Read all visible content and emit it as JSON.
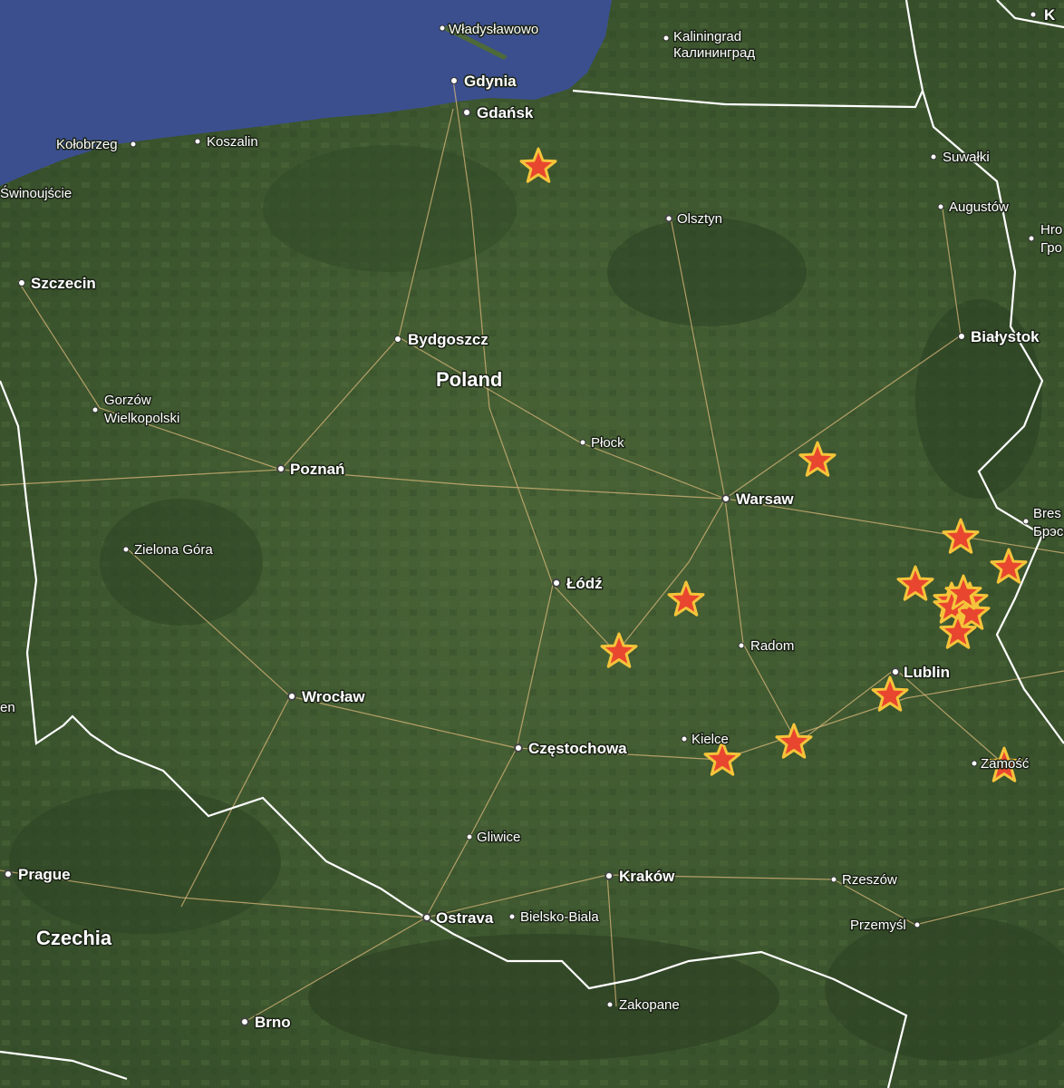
{
  "map": {
    "places": [
      {
        "id": "wladyslawowo",
        "name": "Władysławowo",
        "size": "small"
      },
      {
        "id": "kaliningrad",
        "name": "Kaliningrad",
        "name2": "Калининград",
        "size": "small"
      },
      {
        "id": "gdynia",
        "name": "Gdynia",
        "size": "med"
      },
      {
        "id": "gdansk",
        "name": "Gdańsk",
        "size": "med"
      },
      {
        "id": "kolobrzeg",
        "name": "Kołobrzeg",
        "size": "small"
      },
      {
        "id": "koszalin",
        "name": "Koszalin",
        "size": "small"
      },
      {
        "id": "swinoujscie",
        "name": "Świnoujście",
        "size": "small"
      },
      {
        "id": "suwalki",
        "name": "Suwałki",
        "size": "small"
      },
      {
        "id": "augustow",
        "name": "Augustów",
        "size": "small"
      },
      {
        "id": "olsztyn",
        "name": "Olsztyn",
        "size": "small"
      },
      {
        "id": "szczecin",
        "name": "Szczecin",
        "size": "med"
      },
      {
        "id": "bydgoszcz",
        "name": "Bydgoszcz",
        "size": "med"
      },
      {
        "id": "bialystok",
        "name": "Białystok",
        "size": "med"
      },
      {
        "id": "gorzow",
        "name": "Gorzów",
        "name2": "Wielkopolski",
        "size": "small"
      },
      {
        "id": "plock",
        "name": "Płock",
        "size": "small"
      },
      {
        "id": "poznan",
        "name": "Poznań",
        "size": "med"
      },
      {
        "id": "warsaw",
        "name": "Warsaw",
        "size": "med"
      },
      {
        "id": "zielona",
        "name": "Zielona Góra",
        "size": "small"
      },
      {
        "id": "lodz",
        "name": "Łódź",
        "size": "med"
      },
      {
        "id": "radom",
        "name": "Radom",
        "size": "small"
      },
      {
        "id": "lublin",
        "name": "Lublin",
        "size": "med"
      },
      {
        "id": "wroclaw",
        "name": "Wrocław",
        "size": "med"
      },
      {
        "id": "czestochowa",
        "name": "Częstochowa",
        "size": "med"
      },
      {
        "id": "kielce",
        "name": "Kielce",
        "size": "small"
      },
      {
        "id": "zamosc",
        "name": "Zamość",
        "size": "small"
      },
      {
        "id": "gliwice",
        "name": "Gliwice",
        "size": "small"
      },
      {
        "id": "prague",
        "name": "Prague",
        "size": "med"
      },
      {
        "id": "krakow",
        "name": "Kraków",
        "size": "med"
      },
      {
        "id": "rzeszow",
        "name": "Rzeszów",
        "size": "small"
      },
      {
        "id": "ostrava",
        "name": "Ostrava",
        "size": "med"
      },
      {
        "id": "bielsko",
        "name": "Bielsko-Biala",
        "size": "small"
      },
      {
        "id": "przemysl",
        "name": "Przemyśl",
        "size": "small"
      },
      {
        "id": "zakopane",
        "name": "Zakopane",
        "size": "small"
      },
      {
        "id": "brno",
        "name": "Brno",
        "size": "med"
      },
      {
        "id": "brest",
        "name": "Bres",
        "name2": "Брэс",
        "size": "small"
      },
      {
        "id": "hrodna",
        "name": "Hro",
        "name2": "Гро",
        "size": "small"
      },
      {
        "id": "edge_k",
        "name": "K",
        "size": "med"
      },
      {
        "id": "edge_en",
        "name": "en",
        "size": "small"
      }
    ],
    "countries": [
      {
        "id": "poland",
        "name": "Poland"
      },
      {
        "id": "czechia",
        "name": "Czechia"
      }
    ],
    "markers_count": 17,
    "colors": {
      "sea": "#3b4f8f",
      "land": "#3f5a32",
      "marker_fill": "#e8462e",
      "marker_stroke": "#f5c43a"
    }
  }
}
